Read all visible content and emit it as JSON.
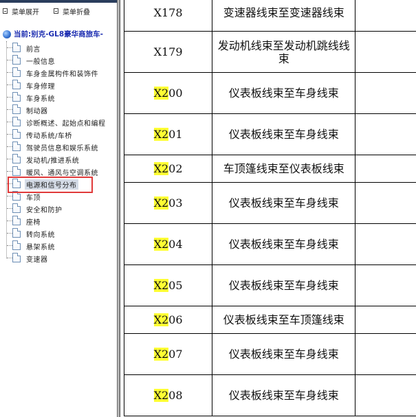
{
  "nav": {
    "menu_expand": "菜单展开",
    "menu_collapse": "菜单折叠",
    "root_label": "当前:别克-GL8豪华商旅车-",
    "items": [
      {
        "label": "前言"
      },
      {
        "label": "一般信息"
      },
      {
        "label": "车身金属构件和装饰件"
      },
      {
        "label": "车身修理"
      },
      {
        "label": "车身系统"
      },
      {
        "label": "制动器"
      },
      {
        "label": "诊断概述、起始点和编程"
      },
      {
        "label": "传动系统/车桥"
      },
      {
        "label": "驾驶员信息和娱乐系统"
      },
      {
        "label": "发动机/推进系统"
      },
      {
        "label": "暖风、通风与空调系统"
      },
      {
        "label": "电源和信号分布",
        "selected": true
      },
      {
        "label": "车顶"
      },
      {
        "label": "安全和防护"
      },
      {
        "label": "座椅"
      },
      {
        "label": "转向系统"
      },
      {
        "label": "悬架系统"
      },
      {
        "label": "变速器"
      }
    ]
  },
  "table": {
    "rows": [
      {
        "prefix": "",
        "code": "X178",
        "description": "变速器线束至变速器线束"
      },
      {
        "prefix": "",
        "code": "X179",
        "description": "发动机线束至发动机跳线线束"
      },
      {
        "prefix": "X2",
        "code": "00",
        "description": "仪表板线束至车身线束"
      },
      {
        "prefix": "X2",
        "code": "01",
        "description": "仪表板线束至车身线束"
      },
      {
        "prefix": "X2",
        "code": "02",
        "description": "车顶篷线束至仪表板线束"
      },
      {
        "prefix": "X2",
        "code": "03",
        "description": "仪表板线束至车身线束"
      },
      {
        "prefix": "X2",
        "code": "04",
        "description": "仪表板线束至车身线束"
      },
      {
        "prefix": "X2",
        "code": "05",
        "description": "仪表板线束至车身线束"
      },
      {
        "prefix": "X2",
        "code": "06",
        "description": "仪表板线束至车顶篷线束"
      },
      {
        "prefix": "X2",
        "code": "07",
        "description": "仪表板线束至车身线束"
      },
      {
        "prefix": "X2",
        "code": "08",
        "description": "仪表板线束至车身线束"
      }
    ],
    "highlight_color": "#ffff33"
  },
  "colors": {
    "root_label": "#1a2bb0",
    "selection_box": "#e03a3a",
    "selected_item_bg": "#d4dbe6"
  }
}
